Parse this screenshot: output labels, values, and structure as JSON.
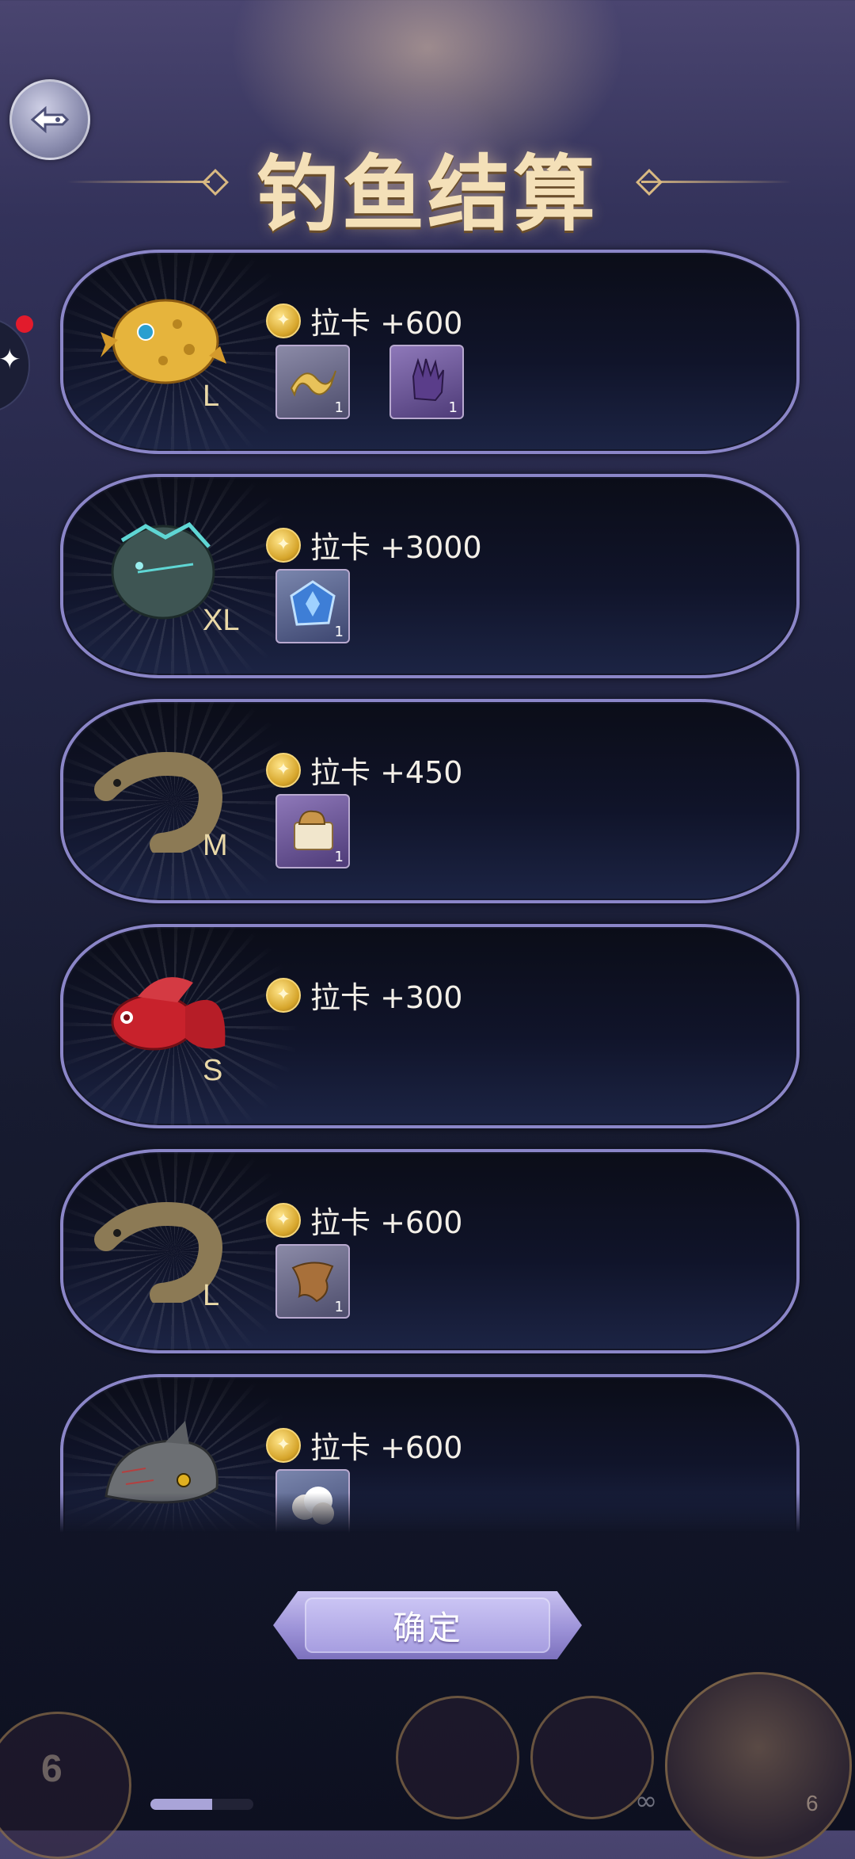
{
  "header": {
    "title": "钓鱼结算",
    "back_icon": "back-fish-icon"
  },
  "colors": {
    "card_border": "#8b86c8",
    "title_gold": "#f4e0b8",
    "button_purple": "#a69de0",
    "notification_dot": "#e21b2c"
  },
  "catches": [
    {
      "fish": "yellow-pufferfish",
      "size": "L",
      "reward": "拉卡 +600",
      "items": [
        {
          "icon": "golden-ribbon-icon",
          "count": "1",
          "tone": "gray"
        },
        {
          "icon": "purple-glove-icon",
          "count": "1",
          "tone": "purple"
        }
      ]
    },
    {
      "fish": "spiky-teal-fish",
      "size": "XL",
      "reward": "拉卡 +3000",
      "items": [
        {
          "icon": "blue-crystal-icon",
          "count": "1",
          "tone": "blue"
        }
      ]
    },
    {
      "fish": "brown-eel",
      "size": "M",
      "reward": "拉卡 +450",
      "items": [
        {
          "icon": "bread-book-icon",
          "count": "1",
          "tone": "purple"
        }
      ]
    },
    {
      "fish": "red-betta",
      "size": "S",
      "reward": "拉卡 +300",
      "items": []
    },
    {
      "fish": "brown-eel",
      "size": "L",
      "reward": "拉卡 +600",
      "items": [
        {
          "icon": "leather-scrap-icon",
          "count": "1",
          "tone": "gray"
        }
      ]
    },
    {
      "fish": "gray-shark-fish",
      "size": "",
      "reward": "拉卡 +600",
      "items": [
        {
          "icon": "white-cotton-icon",
          "count": "",
          "tone": "blue"
        }
      ]
    }
  ],
  "confirm_button": {
    "label": "确定"
  },
  "hud": {
    "level": "6",
    "exp_progress": 0.6,
    "bait_count": "∞",
    "heart_count": "6"
  }
}
